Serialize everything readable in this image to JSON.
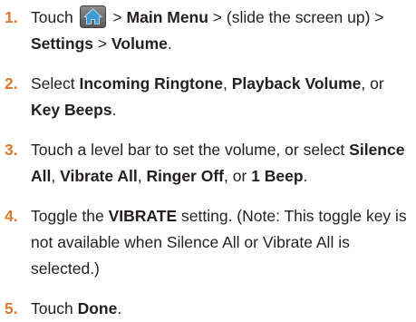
{
  "steps": [
    {
      "number": "1.",
      "parts": {
        "a": "Touch ",
        "b": " > ",
        "c": "Main Menu",
        "d": " > (slide the screen up) > ",
        "e": "Settings",
        "f": " > ",
        "g": "Volume",
        "h": "."
      },
      "icon": "home-icon"
    },
    {
      "number": "2.",
      "parts": {
        "a": "Select ",
        "b": "Incoming Ringtone",
        "c": ", ",
        "d": "Playback Volume",
        "e": ", or ",
        "f": "Key Beeps",
        "g": "."
      }
    },
    {
      "number": "3.",
      "parts": {
        "a": "Touch a level bar to set the volume, or select ",
        "b": "Silence All",
        "c": ", ",
        "d": "Vibrate All",
        "e": ", ",
        "f": "Ringer Off",
        "g": ", or ",
        "h": "1 Beep",
        "i": "."
      }
    },
    {
      "number": "4.",
      "parts": {
        "a": "Toggle the ",
        "b": "VIBRATE",
        "c": " setting. (Note: This toggle key is not available when Silence All or Vibrate All is selected.)"
      }
    },
    {
      "number": "5.",
      "parts": {
        "a": "Touch ",
        "b": "Done",
        "c": "."
      }
    }
  ],
  "colors": {
    "number": "#e0782a",
    "text": "#231f20",
    "icon_bg": "#6b6d70",
    "icon_glyph": "#3d9ad6"
  }
}
